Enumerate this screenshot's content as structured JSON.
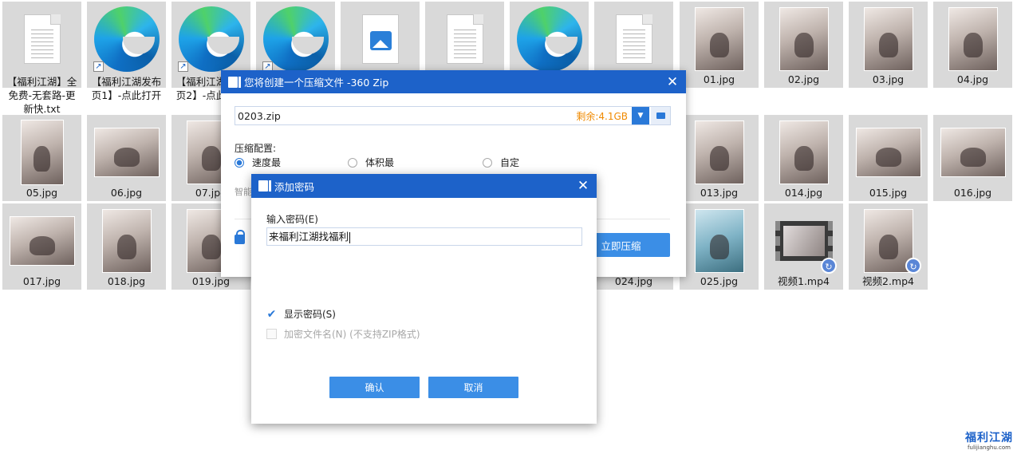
{
  "desktop": {
    "files": [
      {
        "label": "【福利江湖】全免费-无套路-更新快.txt",
        "kind": "doc"
      },
      {
        "label": "【福利江湖发布页1】-点此打开",
        "kind": "edge"
      },
      {
        "label": "【福利江湖发布页2】-点此打开",
        "kind": "edge"
      },
      {
        "label": "",
        "kind": "edge"
      },
      {
        "label": "",
        "kind": "image-file"
      },
      {
        "label": "",
        "kind": "doc"
      },
      {
        "label": "",
        "kind": "edge"
      },
      {
        "label": "",
        "kind": "doc"
      },
      {
        "label": "01.jpg",
        "kind": "photo"
      },
      {
        "label": "02.jpg",
        "kind": "photo"
      },
      {
        "label": "03.jpg",
        "kind": "photo"
      },
      {
        "label": "04.jpg",
        "kind": "photo"
      },
      {
        "label": "05.jpg",
        "kind": "photo"
      },
      {
        "label": "06.jpg",
        "kind": "photo"
      },
      {
        "label": "07.jpg",
        "kind": "photo"
      },
      {
        "label": "013.jpg",
        "kind": "photo"
      },
      {
        "label": "014.jpg",
        "kind": "photo"
      },
      {
        "label": "015.jpg",
        "kind": "photo"
      },
      {
        "label": "016.jpg",
        "kind": "photo"
      },
      {
        "label": "017.jpg",
        "kind": "photo"
      },
      {
        "label": "018.jpg",
        "kind": "photo"
      },
      {
        "label": "019.jpg",
        "kind": "photo"
      },
      {
        "label": "024.jpg",
        "kind": "photo"
      },
      {
        "label": "025.jpg",
        "kind": "photo"
      },
      {
        "label": "视频1.mp4",
        "kind": "video"
      },
      {
        "label": "视频2.mp4",
        "kind": "video"
      }
    ]
  },
  "zip_window": {
    "title": "您将创建一个压缩文件 -360 Zip",
    "close_glyph": "✕",
    "filename": "0203.zip",
    "free_space": "剩余:4.1GB",
    "config_label": "压缩配置:",
    "options": [
      "速度最",
      "体积最",
      "自定"
    ],
    "selected_option": "速度最",
    "smart_text": "智能",
    "compress_button": "立即压缩"
  },
  "password_dialog": {
    "title": "添加密码",
    "close_glyph": "✕",
    "input_label": "输入密码(E)",
    "password_value": "来福利江湖找福利",
    "show_password_label": "显示密码(S)",
    "show_password_checked": true,
    "encrypt_names_label": "加密文件名(N) (不支持ZIP格式)",
    "encrypt_names_checked": false,
    "ok_button": "确认",
    "cancel_button": "取消"
  },
  "watermark": {
    "main": "福利江湖",
    "sub": "fulijianghu.com"
  },
  "colors": {
    "titlebar": "#1d62c9",
    "button": "#3b8ee6",
    "free_space": "#f08a00",
    "tile_bg": "#d9d9d9"
  }
}
